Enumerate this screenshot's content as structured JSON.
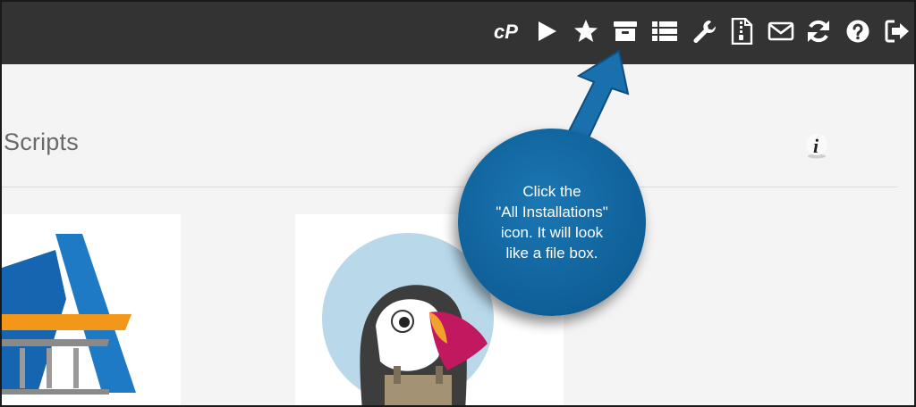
{
  "toolbar": {
    "icons": [
      "cpanel-icon",
      "play-icon",
      "star-icon",
      "file-box-icon",
      "list-icon",
      "wrench-icon",
      "zip-file-icon",
      "envelope-icon",
      "refresh-icon",
      "help-icon",
      "logout-icon"
    ],
    "cpanel_logo_text": "cP"
  },
  "page": {
    "title": "Scripts"
  },
  "callout": {
    "line1": "Click the",
    "line2": "\"All Installations\"",
    "line3": "icon. It will look",
    "line4": "like a file box."
  },
  "colors": {
    "topbar": "#333333",
    "callout": "#0f5f98",
    "background": "#f4f4f4"
  }
}
